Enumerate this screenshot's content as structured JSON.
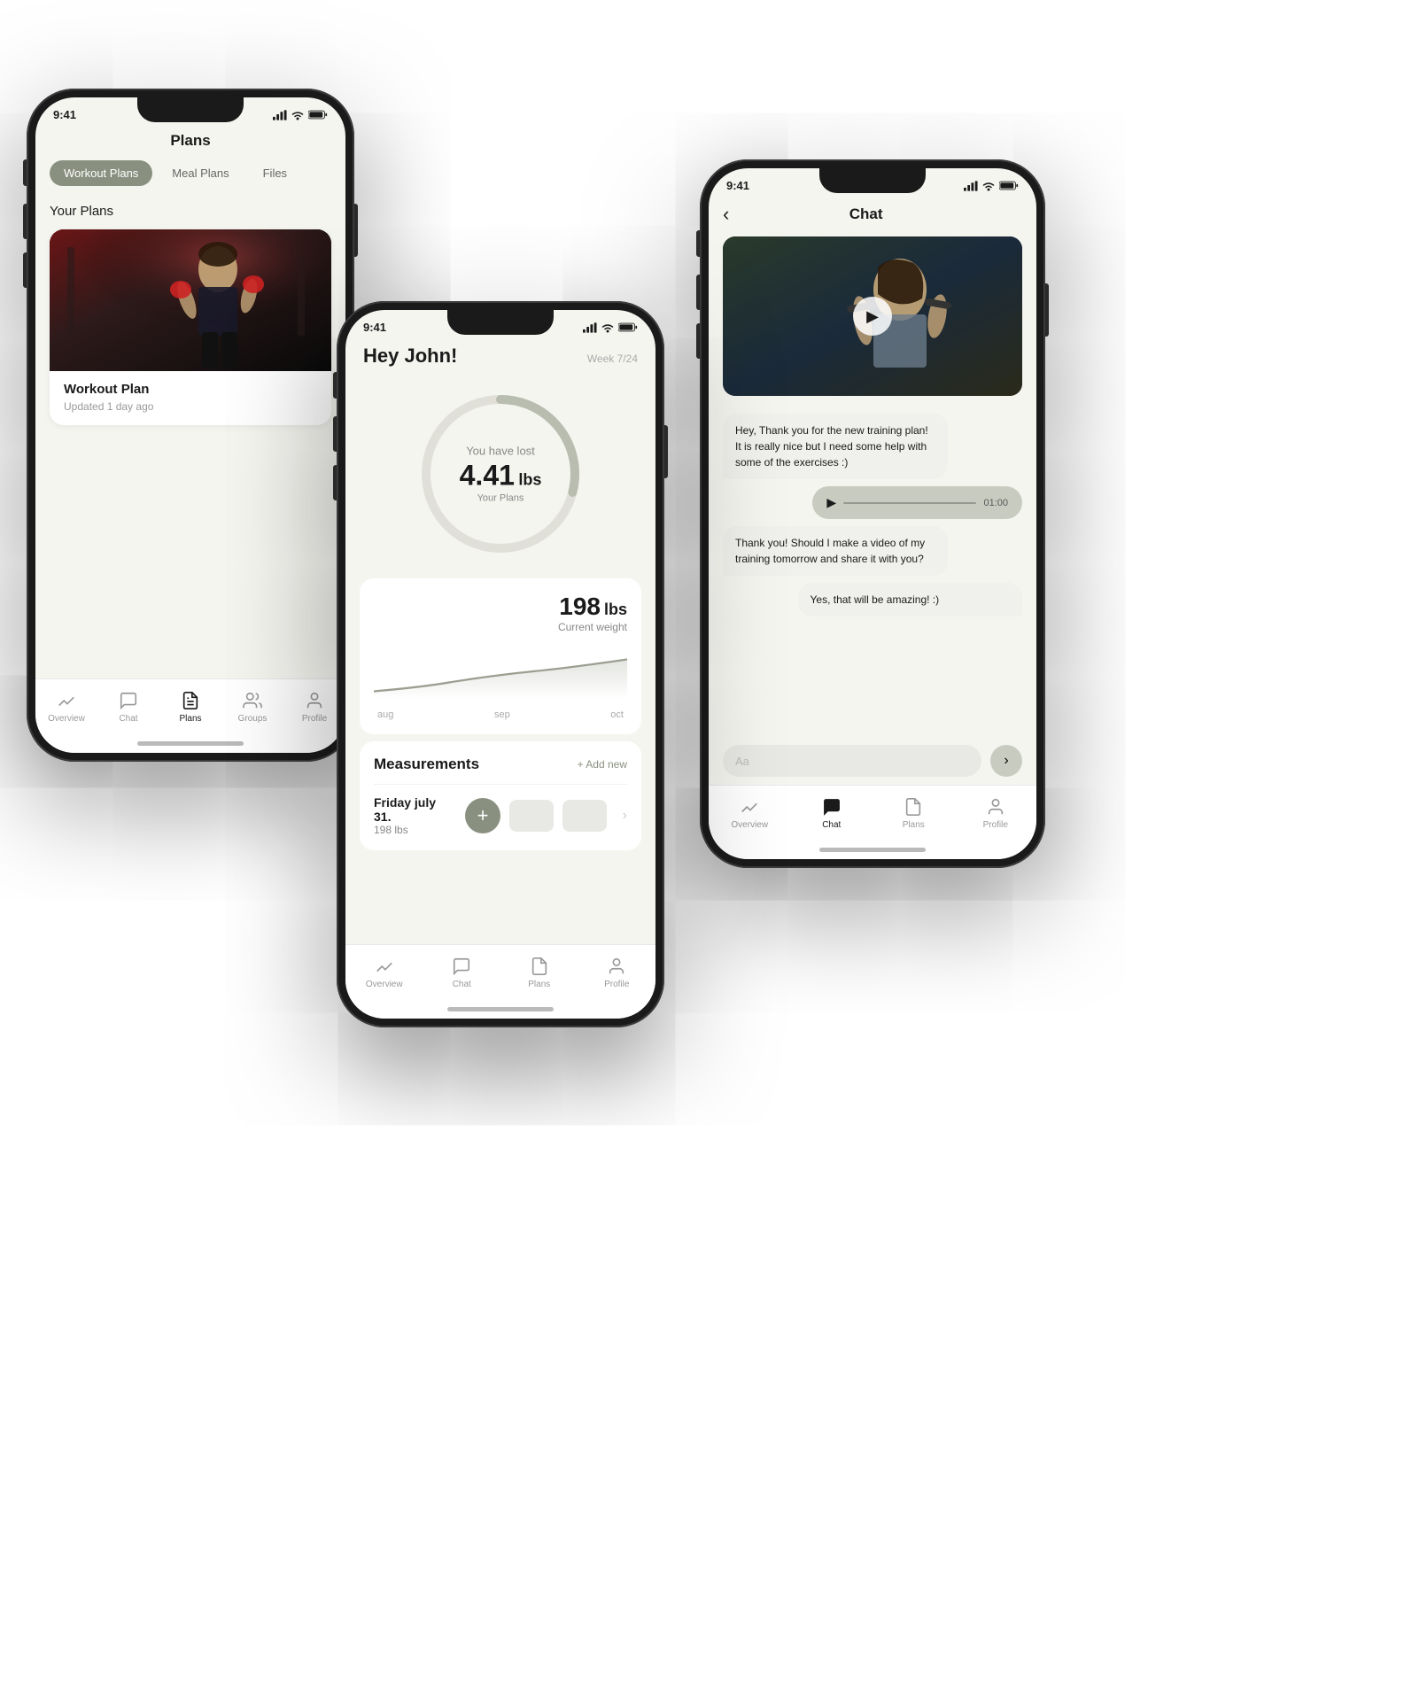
{
  "phone1": {
    "status_time": "9:41",
    "title": "Plans",
    "tabs": [
      "Workout Plans",
      "Meal Plans",
      "Files"
    ],
    "section_title": "Your Plans",
    "plan_card": {
      "title": "Workout Plan",
      "subtitle": "Updated 1 day ago"
    },
    "nav": [
      {
        "label": "Overview",
        "icon": "overview",
        "active": false
      },
      {
        "label": "Chat",
        "icon": "chat",
        "active": false
      },
      {
        "label": "Plans",
        "icon": "plans",
        "active": true
      },
      {
        "label": "Groups",
        "icon": "groups",
        "active": false
      },
      {
        "label": "Profile",
        "icon": "profile",
        "active": false
      }
    ]
  },
  "phone2": {
    "status_time": "9:41",
    "greeting": "Hey John!",
    "week": "Week 7/24",
    "lost_label": "You have lost",
    "lost_value": "4.41",
    "lost_unit": "lbs",
    "ring_sub": "Your Plans",
    "weight_value": "198",
    "weight_unit": "lbs",
    "weight_label": "Current weight",
    "chart_labels": [
      "aug",
      "sep",
      "oct"
    ],
    "measurements_title": "Measurements",
    "add_new": "+ Add new",
    "measurement_date": "Friday july 31.",
    "measurement_weight": "198 lbs",
    "nav": [
      {
        "label": "Overview",
        "icon": "overview",
        "active": false
      },
      {
        "label": "Chat",
        "icon": "chat",
        "active": false
      },
      {
        "label": "Plans",
        "icon": "plans",
        "active": false
      },
      {
        "label": "Profile",
        "icon": "profile",
        "active": false
      }
    ]
  },
  "phone3": {
    "status_time": "9:41",
    "title": "Chat",
    "messages": [
      {
        "type": "received",
        "text": "Hey,\nThank you for the new training plan! It is really nice but I need some help with some of the exercises :)"
      },
      {
        "type": "audio",
        "duration": "01:00"
      },
      {
        "type": "received",
        "text": "Thank you! Should I make a video of my training tomorrow and share it with you?"
      },
      {
        "type": "sent",
        "text": "Yes, that will be amazing! :)"
      }
    ],
    "input_placeholder": "Aa",
    "nav": [
      {
        "label": "Overview",
        "icon": "overview",
        "active": false
      },
      {
        "label": "Chat",
        "icon": "chat",
        "active": true
      },
      {
        "label": "Plans",
        "icon": "plans",
        "active": false
      },
      {
        "label": "Profile",
        "icon": "profile",
        "active": false
      }
    ]
  },
  "colors": {
    "accent": "#8a9080",
    "dark": "#1a1a1a",
    "light_bg": "#f5f5f0",
    "card_bg": "#ffffff",
    "muted": "#999999"
  }
}
